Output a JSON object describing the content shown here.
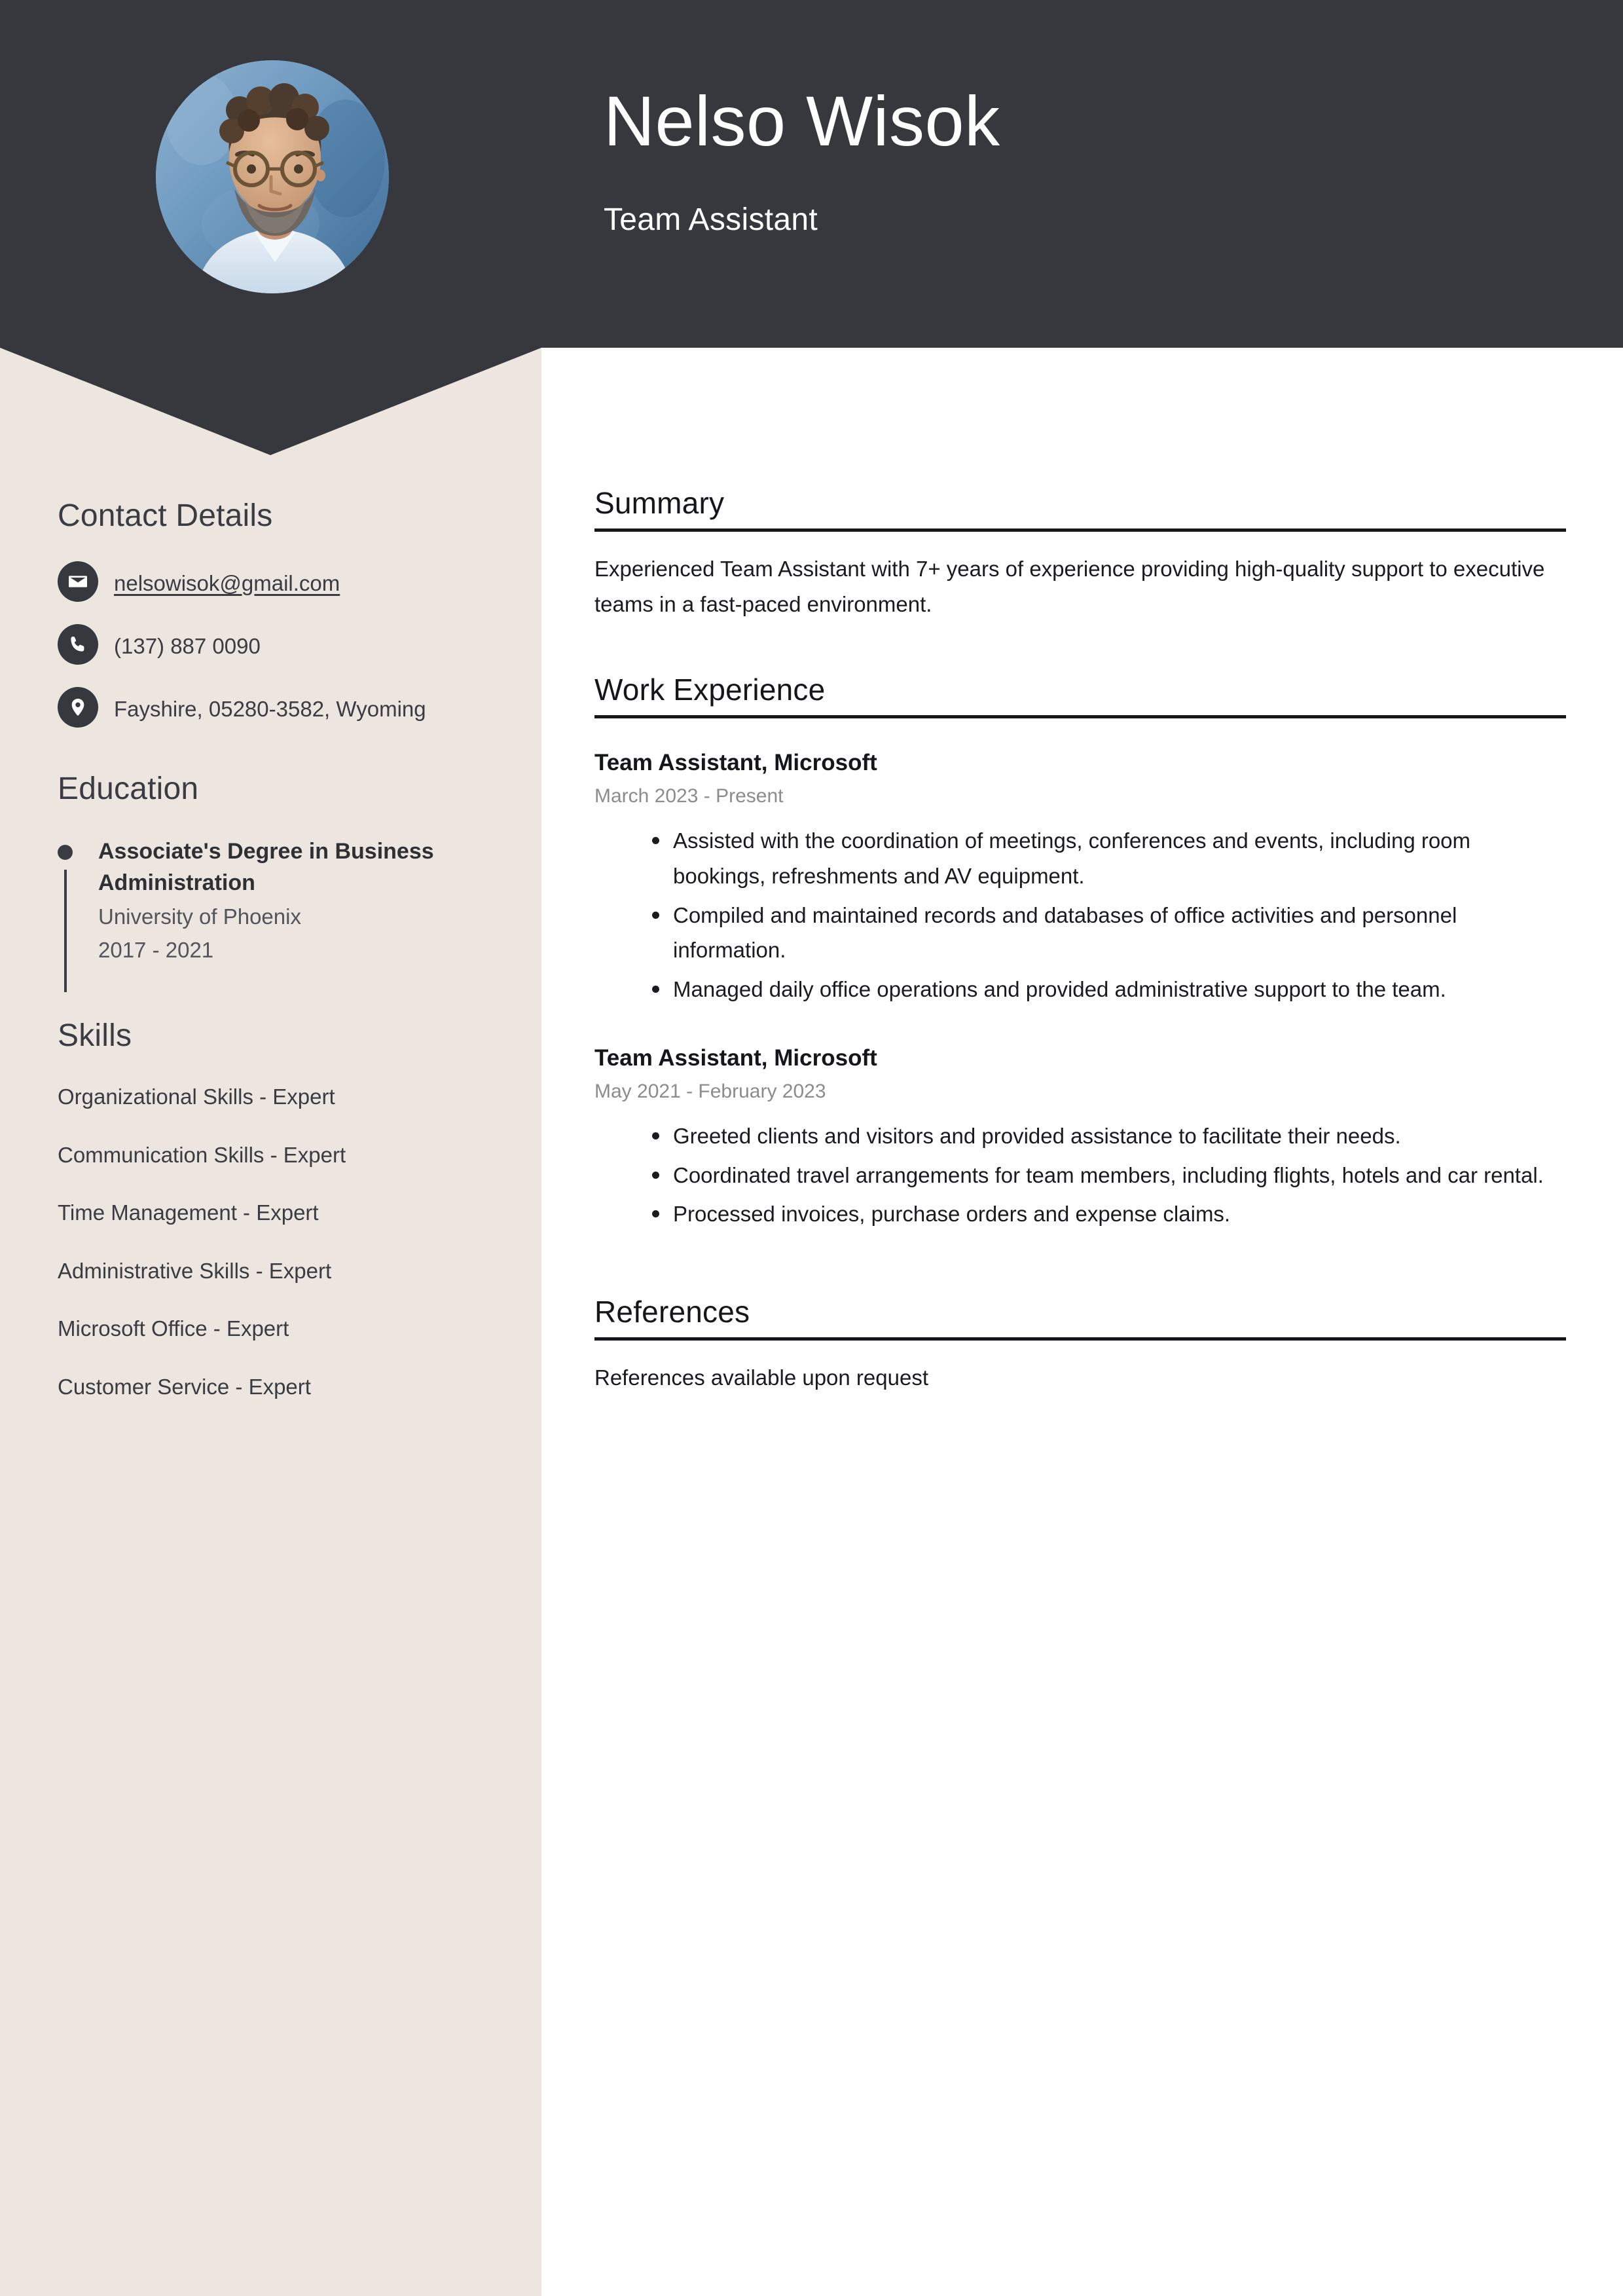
{
  "theme": {
    "header_bg": "#36383D",
    "sidebar_bg": "#EDE5E0",
    "page_bg": "#FFFFFF",
    "text_dark": "#1A1B1F",
    "muted_text": "#8C8C8C"
  },
  "header": {
    "name": "Nelso Wisok",
    "role": "Team Assistant",
    "avatar_alt": "profile-photo"
  },
  "sidebar": {
    "contact": {
      "heading": "Contact Details",
      "items": [
        {
          "icon": "envelope-icon",
          "value": "nelsowisok@gmail.com",
          "link": true
        },
        {
          "icon": "phone-icon",
          "value": "(137) 887 0090",
          "link": false
        },
        {
          "icon": "location-pin-icon",
          "value": "Fayshire, 05280-3582, Wyoming",
          "link": false
        }
      ]
    },
    "education": {
      "heading": "Education",
      "items": [
        {
          "degree": "Associate's Degree in Business Administration",
          "school": "University of Phoenix",
          "dates": "2017 - 2021"
        }
      ]
    },
    "skills": {
      "heading": "Skills",
      "items": [
        "Organizational Skills - Expert",
        "Communication Skills - Expert",
        "Time Management - Expert",
        "Administrative Skills - Expert",
        "Microsoft Office - Expert",
        "Customer Service - Expert"
      ]
    }
  },
  "main": {
    "summary": {
      "heading": "Summary",
      "text": "Experienced Team Assistant with 7+ years of experience providing high-quality support to executive teams in a fast-paced environment."
    },
    "work": {
      "heading": "Work Experience",
      "jobs": [
        {
          "title": "Team Assistant, Microsoft",
          "dates": "March 2023 - Present",
          "bullets": [
            "Assisted with the coordination of meetings, conferences and events, including room bookings, refreshments and AV equipment.",
            "Compiled and maintained records and databases of office activities and personnel information.",
            "Managed daily office operations and provided administrative support to the team."
          ]
        },
        {
          "title": "Team Assistant, Microsoft",
          "dates": "May 2021 - February 2023",
          "bullets": [
            "Greeted clients and visitors and provided assistance to facilitate their needs.",
            "Coordinated travel arrangements for team members, including flights, hotels and car rental.",
            "Processed invoices, purchase orders and expense claims."
          ]
        }
      ]
    },
    "references": {
      "heading": "References",
      "text": "References available upon request"
    }
  }
}
